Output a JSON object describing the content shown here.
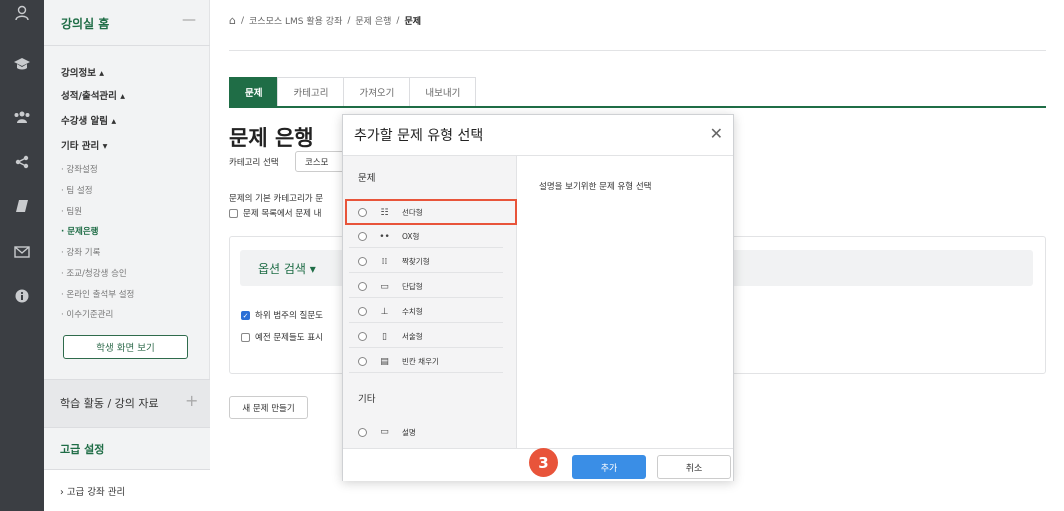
{
  "rail": {
    "icons": [
      "user-icon",
      "graduation-cap-icon",
      "group-icon",
      "share-icon",
      "book-icon",
      "envelope-icon",
      "info-icon"
    ]
  },
  "sidebar": {
    "head": {
      "label": "강의실 홈",
      "collapse": "—"
    },
    "menus": [
      {
        "label": "강의정보 ▴"
      },
      {
        "label": "성적/출석관리 ▴"
      },
      {
        "label": "수강생 알림 ▴"
      },
      {
        "label": "기타 관리 ▾"
      }
    ],
    "items": [
      {
        "label": "· 강좌설정"
      },
      {
        "label": "· 팀 설정"
      },
      {
        "label": "· 팀원"
      },
      {
        "label": "· 문제은행"
      },
      {
        "label": "· 강좌 기록"
      },
      {
        "label": "· 조교/청강생 승인"
      },
      {
        "label": "· 온라인 출석부 설정"
      },
      {
        "label": "· 이수기준관리"
      }
    ],
    "student_view": "학생 화면 보기",
    "activities": {
      "label": "학습 활동 / 강의 자료",
      "plus": "+"
    },
    "advanced": {
      "label": "고급 설정"
    },
    "advanced_course": {
      "label": "› 고급 강좌 관리"
    }
  },
  "breadcrumb": {
    "home": "⌂",
    "sep": "/",
    "course": "코스모스 LMS 활용 강좌",
    "bank": "문제 은행",
    "current": "문제"
  },
  "tabs": [
    {
      "label": "문제"
    },
    {
      "label": "카테고리"
    },
    {
      "label": "가져오기"
    },
    {
      "label": "내보내기"
    }
  ],
  "main": {
    "title": "문제 은행",
    "category_label": "카테고리 선택",
    "category_value": "코스모",
    "info_line": "문제의 기본 카테고리가 문",
    "checkbox_list_label": "문제 목록에서 문제 내",
    "option_search": "옵션 검색 ▾",
    "sub_category_label": "하위 범주의 질문도",
    "old_questions_label": "예전 문제들도 표시",
    "new_question_button": "새 문제 만들기"
  },
  "modal": {
    "title": "추가할 문제 유형 선택",
    "close": "✕",
    "group_question": "문제",
    "group_other": "기타",
    "types": [
      {
        "label": "선다형",
        "icon": "list-icon",
        "glyph": "☷"
      },
      {
        "label": "OX형",
        "icon": "dots-icon",
        "glyph": "••"
      },
      {
        "label": "짝찾기형",
        "icon": "matching-icon",
        "glyph": "⁞⁞"
      },
      {
        "label": "단답형",
        "icon": "short-answer-icon",
        "glyph": "▭"
      },
      {
        "label": "수치형",
        "icon": "numeric-icon",
        "glyph": "⊥"
      },
      {
        "label": "서술형",
        "icon": "essay-icon",
        "glyph": "▯"
      },
      {
        "label": "빈칸 채우기",
        "icon": "fill-blank-icon",
        "glyph": "▤"
      }
    ],
    "other_types": [
      {
        "label": "설명",
        "icon": "description-icon",
        "glyph": "▭"
      }
    ],
    "description": "설명을 보기위한 문제 유형 선택",
    "add_button": "추가",
    "cancel_button": "취소"
  },
  "step_badge": "3",
  "colors": {
    "brand_green": "#1f6d46",
    "add_blue": "#3a8ee6",
    "highlight_red": "#e8543a",
    "rail": "#3b3e43"
  }
}
